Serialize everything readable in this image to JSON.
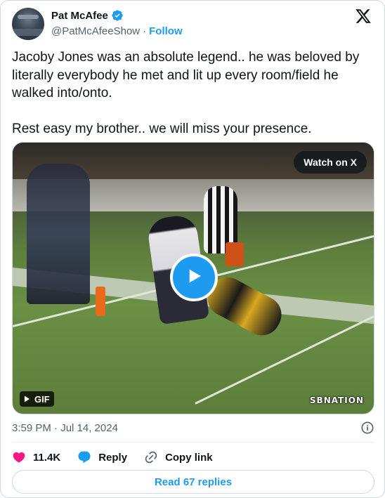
{
  "author": {
    "display_name": "Pat McAfee",
    "handle": "@PatMcAfeeShow",
    "separator": "·",
    "follow_label": "Follow"
  },
  "tweet": {
    "paragraph_1": "Jacoby Jones was an absolute legend.. he was beloved by literally everybody he met and lit up every room/field he walked into/onto.",
    "paragraph_2": "Rest easy my brother.. we will miss your presence."
  },
  "media": {
    "watch_label": "Watch on X",
    "gif_label": "GIF",
    "watermark": "SBNATION"
  },
  "meta": {
    "timestamp": "3:59 PM · Jul 14, 2024"
  },
  "actions": {
    "likes": "11.4K",
    "reply_label": "Reply",
    "copy_link_label": "Copy link"
  },
  "footer": {
    "read_replies_label": "Read 67 replies"
  },
  "colors": {
    "accent": "#1d9bf0",
    "like": "#f91880",
    "muted_text": "#536471"
  }
}
